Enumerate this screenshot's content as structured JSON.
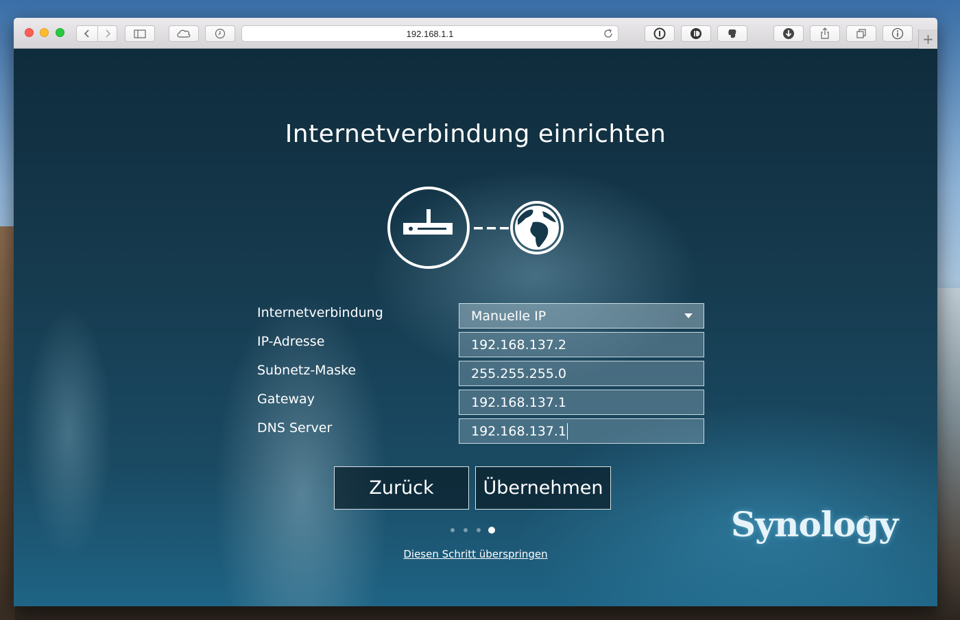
{
  "browser": {
    "url": "192.168.1.1"
  },
  "page": {
    "title": "Internetverbindung einrichten"
  },
  "form": {
    "rows": [
      {
        "label": "Internetverbindung",
        "value": "Manuelle IP",
        "type": "select"
      },
      {
        "label": "IP-Adresse",
        "value": "192.168.137.2",
        "type": "input"
      },
      {
        "label": "Subnetz-Maske",
        "value": "255.255.255.0",
        "type": "input"
      },
      {
        "label": "Gateway",
        "value": "192.168.137.1",
        "type": "input"
      },
      {
        "label": "DNS Server",
        "value": "192.168.137.1",
        "type": "input"
      }
    ]
  },
  "buttons": {
    "back_label": "Zurück",
    "apply_label": "Übernehmen"
  },
  "steps": {
    "total": 4,
    "current": 4
  },
  "skip_label": "Diesen Schritt überspringen",
  "brand": {
    "name": "Synology",
    "mark": "®"
  },
  "colors": {
    "traffic_red": "#fc5f57",
    "traffic_yellow": "#fdbc2e",
    "traffic_green": "#2ac940"
  }
}
